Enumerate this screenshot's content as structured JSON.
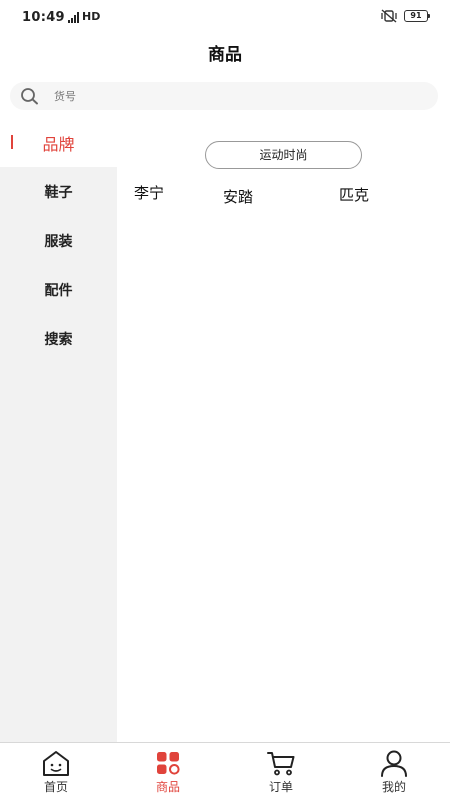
{
  "status_bar": {
    "time": "10:49",
    "network": "HD",
    "battery": "91"
  },
  "header": {
    "title": "商品"
  },
  "search": {
    "placeholder": "货号",
    "value": ""
  },
  "sidebar": {
    "items": [
      {
        "label": "品牌",
        "active": true
      },
      {
        "label": "鞋子",
        "active": false
      },
      {
        "label": "服装",
        "active": false
      },
      {
        "label": "配件",
        "active": false
      },
      {
        "label": "搜索",
        "active": false
      }
    ]
  },
  "content": {
    "category_label": "运动时尚",
    "brands": [
      "李宁",
      "安踏",
      "匹克"
    ]
  },
  "bottom_nav": {
    "items": [
      {
        "label": "首页",
        "icon": "home-icon",
        "active": false
      },
      {
        "label": "商品",
        "icon": "products-icon",
        "active": true
      },
      {
        "label": "订单",
        "icon": "cart-icon",
        "active": false
      },
      {
        "label": "我的",
        "icon": "user-icon",
        "active": false
      }
    ]
  },
  "colors": {
    "accent": "#e0433b",
    "sidebar_bg": "#f2f2f2",
    "search_bg": "#f6f6f6"
  }
}
